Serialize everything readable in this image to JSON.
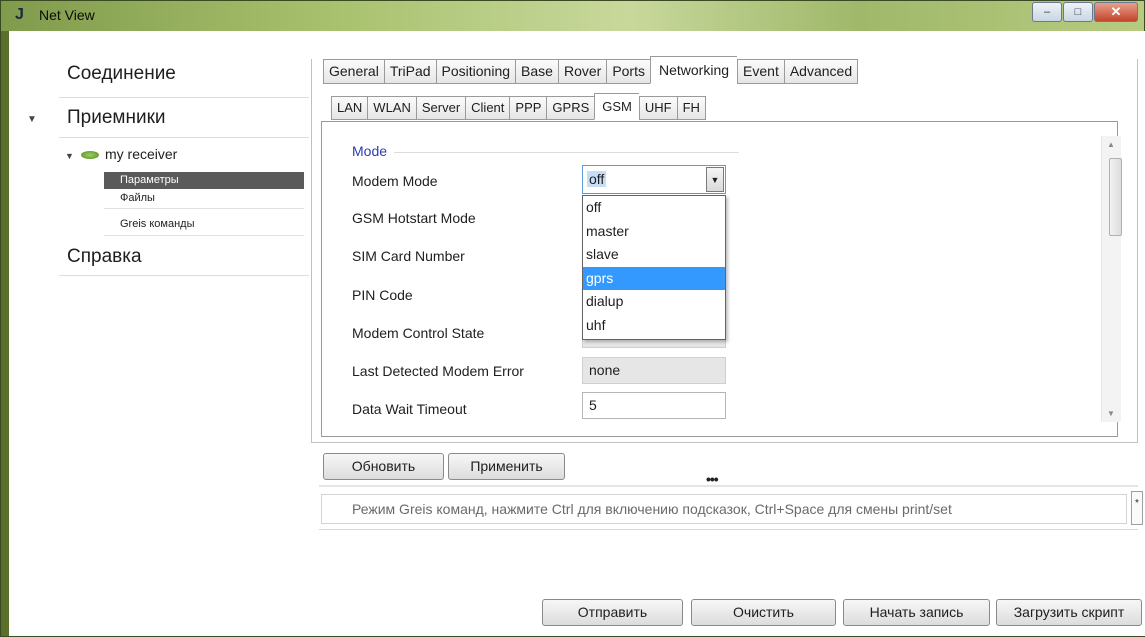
{
  "window": {
    "title": "Net View",
    "app_icon": "J"
  },
  "sidebar": {
    "connection": "Соединение",
    "receivers": "Приемники",
    "receiver_name": "my receiver",
    "sub_items": [
      "Параметры",
      "Файлы",
      "Greis команды"
    ],
    "help": "Справка"
  },
  "tabs_main": [
    "General",
    "TriPad",
    "Positioning",
    "Base",
    "Rover",
    "Ports",
    "Networking",
    "Event",
    "Advanced"
  ],
  "tabs_main_active": "Networking",
  "tabs_sub": [
    "LAN",
    "WLAN",
    "Server",
    "Client",
    "PPP",
    "GPRS",
    "GSM",
    "UHF",
    "FH"
  ],
  "tabs_sub_active": "GSM",
  "group": {
    "title": "Mode"
  },
  "fields": {
    "modem_mode": {
      "label": "Modem Mode",
      "value": "off"
    },
    "gsm_hotstart": {
      "label": "GSM Hotstart Mode"
    },
    "sim_card": {
      "label": "SIM Card Number"
    },
    "pin_code": {
      "label": "PIN Code"
    },
    "modem_control_state": {
      "label": "Modem Control State"
    },
    "last_error": {
      "label": "Last Detected Modem Error",
      "value": "none"
    },
    "data_wait_timeout": {
      "label": "Data Wait Timeout",
      "value": "5"
    }
  },
  "dropdown": {
    "options": [
      "off",
      "master",
      "slave",
      "gprs",
      "dialup",
      "uhf"
    ],
    "highlighted": "gprs"
  },
  "buttons": {
    "refresh": "Обновить",
    "apply": "Применить",
    "send": "Отправить",
    "clear": "Очистить",
    "start_record": "Начать запись",
    "load_script": "Загрузить скрипт"
  },
  "console": {
    "placeholder": "Режим Greis команд, нажмите  Ctrl для включению подсказок, Ctrl+Space для смены print/set"
  },
  "splitter": "•••"
}
